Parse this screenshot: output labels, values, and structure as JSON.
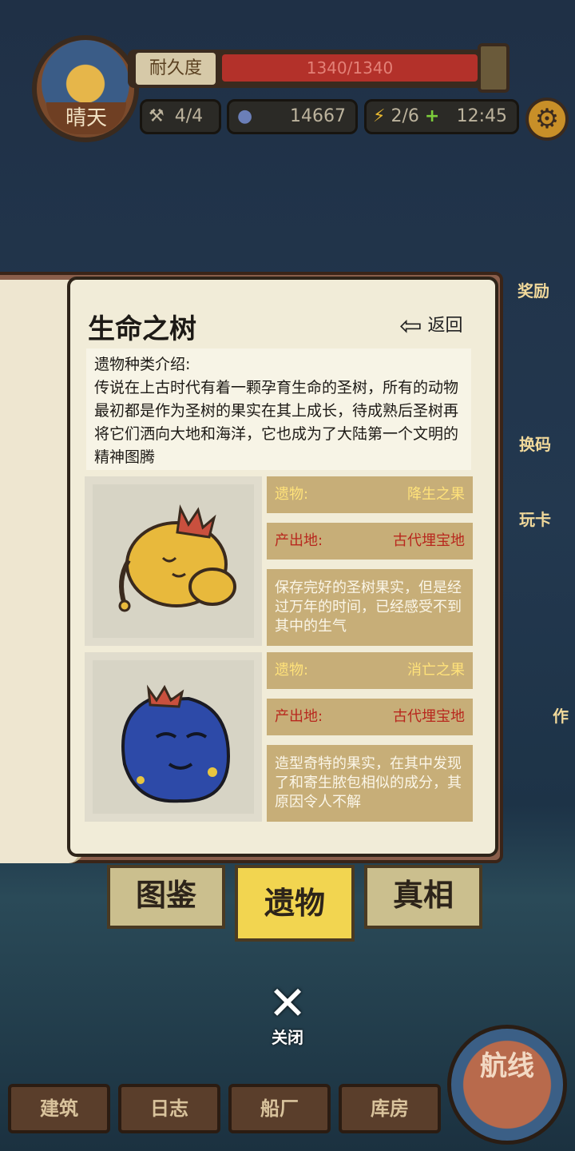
{
  "hud": {
    "weather": "晴天",
    "durability_label": "耐久度",
    "durability_value": "1340/1340",
    "durability_fraction": 1.0,
    "tools": "4/4",
    "coins": "14667",
    "energy": "2/6",
    "timer": "12:45"
  },
  "side": {
    "reward": "奖励",
    "exchange": "换码",
    "card": "玩卡",
    "work": "作"
  },
  "book": {
    "title": "生命之树",
    "back_label": "返回",
    "intro_heading": "遗物种类介绍:",
    "intro_text": "传说在上古时代有着一颗孕育生命的圣树，所有的动物最初都是作为圣树的果实在其上成长，待成熟后圣树再将它们洒向大地和海洋，它也成为了大陆第一个文明的精神图腾",
    "items": [
      {
        "relic_key": "遗物:",
        "relic_value": "降生之果",
        "origin_key": "产出地:",
        "origin_value": "古代埋宝地",
        "description": "保存完好的圣树果实，但是经过万年的时间，已经感受不到其中的生气"
      },
      {
        "relic_key": "遗物:",
        "relic_value": "消亡之果",
        "origin_key": "产出地:",
        "origin_value": "古代埋宝地",
        "description": "造型奇特的果实，在其中发现了和寄生脓包相似的成分，其原因令人不解"
      }
    ]
  },
  "tabs": [
    "图鉴",
    "遗物",
    "真相"
  ],
  "close_label": "关闭",
  "nav": [
    "建筑",
    "日志",
    "船厂",
    "库房"
  ],
  "route_label": "航线",
  "colors": {
    "relic_text": "#ffe27a",
    "origin_text": "#b8281e",
    "active_tab": "#f2d550",
    "durability_bar": "#b3312a"
  }
}
